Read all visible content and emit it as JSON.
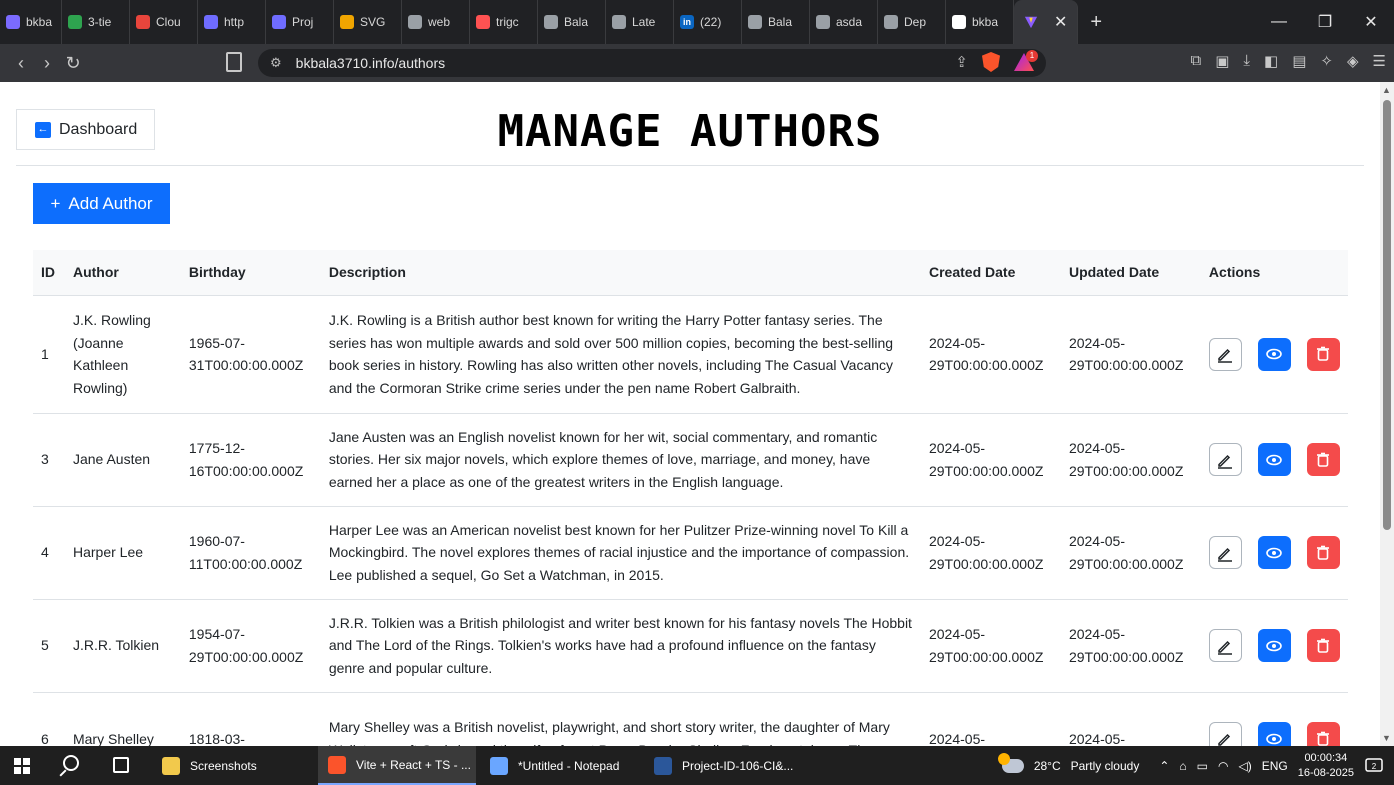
{
  "browser": {
    "tabs": [
      {
        "label": "bkba",
        "color": "#7b6bff",
        "glyph": ""
      },
      {
        "label": "3-tie",
        "color": "#2ea44f",
        "glyph": ""
      },
      {
        "label": "Clou",
        "color": "#e8453c",
        "glyph": ""
      },
      {
        "label": "http",
        "color": "#6f6cff",
        "glyph": ""
      },
      {
        "label": "Proj",
        "color": "#6f6cff",
        "glyph": ""
      },
      {
        "label": "SVG",
        "color": "#f0a500",
        "glyph": ""
      },
      {
        "label": "web",
        "color": "#9aa0a6",
        "glyph": ""
      },
      {
        "label": "trigc",
        "color": "#ff5252",
        "glyph": ""
      },
      {
        "label": "Bala",
        "color": "#9aa0a6",
        "glyph": ""
      },
      {
        "label": "Late",
        "color": "#9aa0a6",
        "glyph": ""
      },
      {
        "label": "(22)",
        "color": "#0a66c2",
        "glyph": "in"
      },
      {
        "label": "Bala",
        "color": "#9aa0a6",
        "glyph": ""
      },
      {
        "label": "asda",
        "color": "#9aa0a6",
        "glyph": ""
      },
      {
        "label": "Dep",
        "color": "#9aa0a6",
        "glyph": ""
      },
      {
        "label": "bkba",
        "color": "#ffffff",
        "glyph": ""
      }
    ],
    "active_tab_color": "#8a5cff",
    "url": "bkbala3710.info/authors",
    "notification_count": "1"
  },
  "page": {
    "dashboard_label": "Dashboard",
    "title": "MANAGE AUTHORS",
    "add_label": "Add Author",
    "add_icon": "+"
  },
  "table": {
    "headers": [
      "ID",
      "Author",
      "Birthday",
      "Description",
      "Created Date",
      "Updated Date",
      "Actions"
    ],
    "rows": [
      {
        "id": "1",
        "author": "J.K. Rowling (Joanne Kathleen Rowling)",
        "birthday": "1965-07-31T00:00:00.000Z",
        "description": "J.K. Rowling is a British author best known for writing the Harry Potter fantasy series. The series has won multiple awards and sold over 500 million copies, becoming the best-selling book series in history. Rowling has also written other novels, including The Casual Vacancy and the Cormoran Strike crime series under the pen name Robert Galbraith.",
        "created": "2024-05-29T00:00:00.000Z",
        "updated": "2024-05-29T00:00:00.000Z"
      },
      {
        "id": "3",
        "author": "Jane Austen",
        "birthday": "1775-12-16T00:00:00.000Z",
        "description": "Jane Austen was an English novelist known for her wit, social commentary, and romantic stories. Her six major novels, which explore themes of love, marriage, and money, have earned her a place as one of the greatest writers in the English language.",
        "created": "2024-05-29T00:00:00.000Z",
        "updated": "2024-05-29T00:00:00.000Z"
      },
      {
        "id": "4",
        "author": "Harper Lee",
        "birthday": "1960-07-11T00:00:00.000Z",
        "description": "Harper Lee was an American novelist best known for her Pulitzer Prize-winning novel To Kill a Mockingbird. The novel explores themes of racial injustice and the importance of compassion. Lee published a sequel, Go Set a Watchman, in 2015.",
        "created": "2024-05-29T00:00:00.000Z",
        "updated": "2024-05-29T00:00:00.000Z"
      },
      {
        "id": "5",
        "author": "J.R.R. Tolkien",
        "birthday": "1954-07-29T00:00:00.000Z",
        "description": "J.R.R. Tolkien was a British philologist and writer best known for his fantasy novels The Hobbit and The Lord of the Rings. Tolkien's works have had a profound influence on the fantasy genre and popular culture.",
        "created": "2024-05-29T00:00:00.000Z",
        "updated": "2024-05-29T00:00:00.000Z"
      },
      {
        "id": "6",
        "author": "Mary Shelley",
        "birthday": "1818-03-",
        "description": "Mary Shelley was a British novelist, playwright, and short story writer, the daughter of Mary Wollstonecraft Godwin and the wife of poet Percy Bysshe Shelley. Frankenstein, or, The",
        "created": "2024-05-",
        "updated": "2024-05-"
      }
    ]
  },
  "taskbar": {
    "apps": [
      {
        "label": "Screenshots",
        "color": "#f2c94c"
      },
      {
        "label": "Vite + React + TS - ...",
        "color": "#fb542b"
      },
      {
        "label": "*Untitled - Notepad",
        "color": "#6aa6ff"
      },
      {
        "label": "Project-ID-106-CI&...",
        "color": "#2b579a"
      }
    ],
    "weather_temp": "28°C",
    "weather_text": "Partly cloudy",
    "weather_badge": "3",
    "lang": "ENG",
    "time": "00:00:34",
    "date": "16-08-2025",
    "notif_count": "2"
  },
  "colors": {
    "primary": "#0d6efd",
    "danger": "#f44b4b"
  }
}
